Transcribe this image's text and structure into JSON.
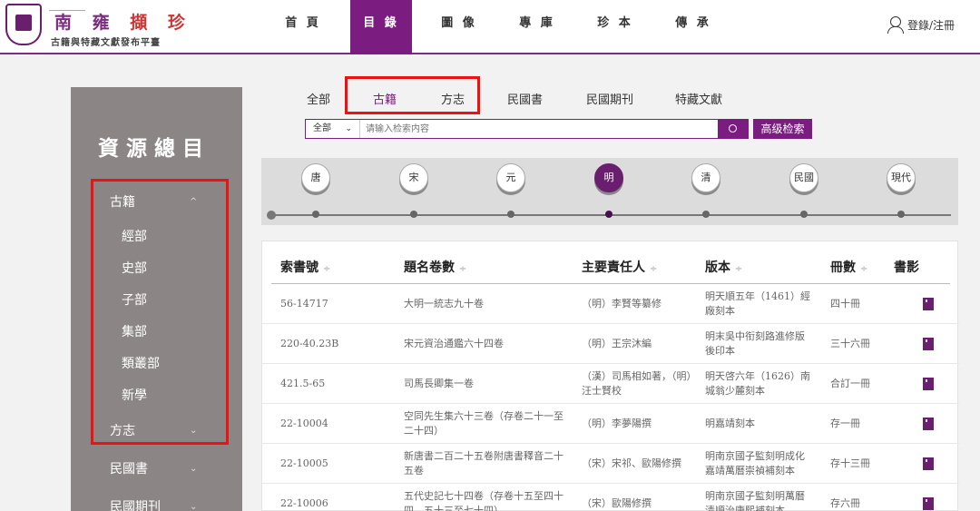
{
  "header": {
    "brand_title_part1": "南 雍 ",
    "brand_title_part2": "擷 珍",
    "brand_subtitle": "古籍與特藏文獻發布平臺",
    "nav": [
      "首 頁",
      "目 錄",
      "圖 像",
      "專 庫",
      "珍 本",
      "傳 承"
    ],
    "nav_active": "目 錄",
    "login_label": "登錄/注冊"
  },
  "sidebar": {
    "title": "資源總目",
    "items": [
      {
        "label": "古籍",
        "chevron": "^"
      },
      {
        "label": "經部"
      },
      {
        "label": "史部"
      },
      {
        "label": "子部"
      },
      {
        "label": "集部"
      },
      {
        "label": "類叢部"
      },
      {
        "label": "新學"
      },
      {
        "label": "方志",
        "chevron": "⌄"
      },
      {
        "label": "民國書",
        "chevron": "⌄"
      },
      {
        "label": "民國期刊",
        "chevron": "⌄"
      }
    ]
  },
  "tabs": [
    "全部",
    "古籍",
    "方志",
    "民國書",
    "民國期刊",
    "特藏文獻"
  ],
  "tabs_active": "古籍",
  "search": {
    "scope": "全部",
    "scope_chevron": "⌄",
    "placeholder": "请输入检索内容",
    "advanced_label": "高级检索"
  },
  "timeline": {
    "dynasties": [
      "唐",
      "宋",
      "元",
      "明",
      "清",
      "民國",
      "現代"
    ],
    "active": "明"
  },
  "table": {
    "headers": [
      "索書號",
      "題名卷數",
      "主要責任人",
      "版本",
      "冊數",
      "書影"
    ],
    "sort_glyph": "÷",
    "rows": [
      {
        "call_no": "56-14717",
        "title": "大明一統志九十卷",
        "author": "（明）李賢等纂修",
        "edition": "明天順五年（1461）經廠刻本",
        "volumes": "四十冊"
      },
      {
        "call_no": "220-40.23B",
        "title": "宋元資治通鑑六十四卷",
        "author": "（明）王宗沐編",
        "edition": "明末吳中衔刻路進修版後印本",
        "volumes": "三十六冊"
      },
      {
        "call_no": "421.5-65",
        "title": "司馬長卿集一卷",
        "author": "（漢）司馬相如著，（明）汪士賢校",
        "edition": "明天啓六年（1626）南城翁少麓刻本",
        "volumes": "合訂一冊"
      },
      {
        "call_no": "22-10004",
        "title": "空同先生集六十三卷（存卷二十一至二十四）",
        "author": "（明）李夢陽撰",
        "edition": "明嘉靖刻本",
        "volumes": "存一冊"
      },
      {
        "call_no": "22-10005",
        "title": "新唐書二百二十五卷附唐書釋音二十五卷",
        "author": "（宋）宋祁、歐陽修撰",
        "edition": "明南京國子監刻明成化嘉靖萬曆崇禎補刻本",
        "volumes": "存十三冊"
      },
      {
        "call_no": "22-10006",
        "title": "五代史記七十四卷（存卷十五至四十四、五十三至七十四）",
        "author": "（宋）歐陽修撰",
        "edition": "明南京國子監刻明萬曆清順治康熙補刻本",
        "volumes": "存六冊"
      }
    ]
  },
  "colors": {
    "accent": "#7b1d80",
    "sidebar_bg": "#8c8586",
    "highlight_box": "#e11111"
  }
}
